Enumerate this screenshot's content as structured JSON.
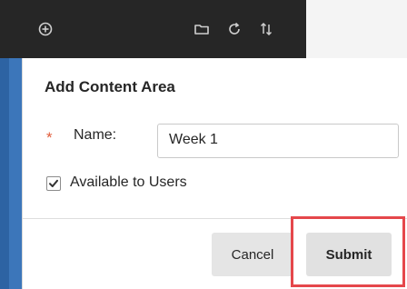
{
  "toolbar": {
    "icons": [
      "add-circle-icon",
      "folder-icon",
      "refresh-icon",
      "sort-icon"
    ]
  },
  "dialog": {
    "title": "Add Content Area",
    "name_required_marker": "*",
    "name_label": "Name:",
    "name_value": "Week 1",
    "available_label": "Available to Users",
    "available_checked": true,
    "cancel_label": "Cancel",
    "submit_label": "Submit"
  },
  "colors": {
    "toolbar_bg": "#262626",
    "accent_blue": "#2d63a3",
    "required": "#e15c3a",
    "highlight": "#e5474b"
  }
}
